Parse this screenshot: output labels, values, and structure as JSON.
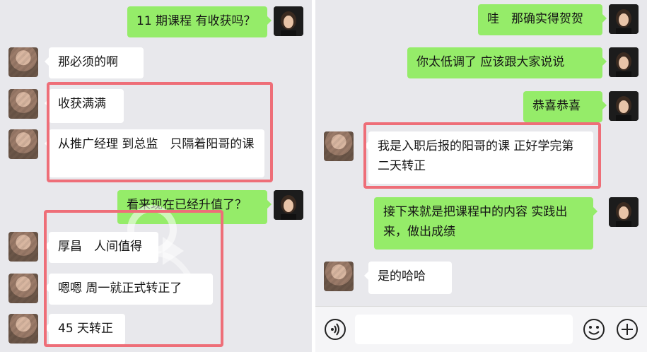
{
  "screenshots": [
    {
      "messages": [
        {
          "side": "right",
          "text": "11 期课程 有收获吗？"
        },
        {
          "side": "left",
          "text": "那必须的啊"
        },
        {
          "side": "left",
          "text": "收获满满"
        },
        {
          "side": "left",
          "text": "从推广经理 到总监　只隔着阳哥的课"
        },
        {
          "side": "right",
          "text": "看来现在已经升值了？"
        },
        {
          "side": "left",
          "text": "厚昌　人间值得"
        },
        {
          "side": "left",
          "text": "嗯嗯  周一就正式转正了"
        },
        {
          "side": "left",
          "text": "45 天转正"
        }
      ]
    },
    {
      "messages": [
        {
          "side": "right",
          "text": "哇　那确实得贺贺"
        },
        {
          "side": "right",
          "text": "你太低调了 应该跟大家说说"
        },
        {
          "side": "right",
          "text": "恭喜恭喜"
        },
        {
          "side": "left",
          "text": "我是入职后报的阳哥的课  正好学完第二天转正"
        },
        {
          "side": "right",
          "text": "接下来就是把课程中的内容 实践出来，做出成绩"
        },
        {
          "side": "left",
          "text": "是的哈哈"
        }
      ],
      "input_bar": {
        "voice_icon": "voice-icon",
        "emoji_icon": "emoji-icon",
        "plus_icon": "plus-icon"
      }
    }
  ],
  "colors": {
    "chat_background": "#e8e8ec",
    "sent_bubble": "#95ec69",
    "received_bubble": "#ffffff",
    "highlight_border": "#ee6e78"
  }
}
